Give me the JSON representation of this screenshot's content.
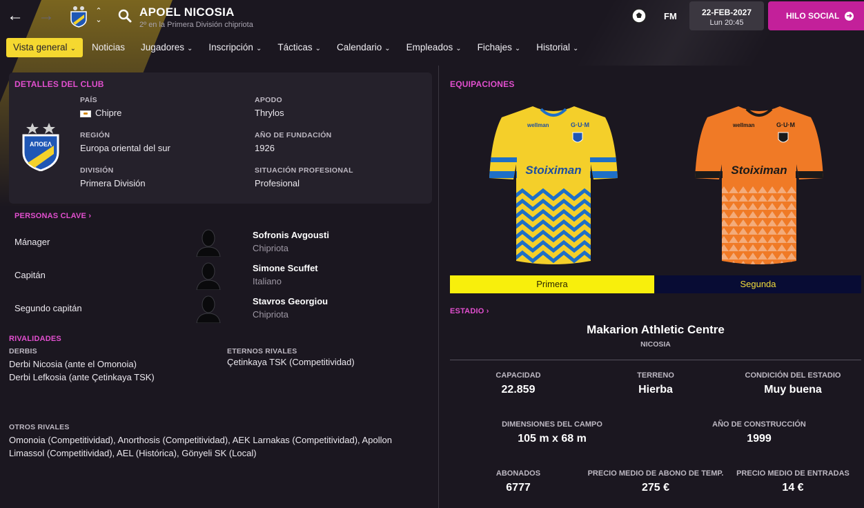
{
  "header": {
    "club_name": "APOEL NICOSIA",
    "club_subtitle": "2º en la Primera División chipriota",
    "fm_label": "FM",
    "date": "22-FEB-2027",
    "time": "Lun 20:45",
    "social_button": "HILO SOCIAL"
  },
  "menu": [
    {
      "label": "Vista general",
      "dropdown": true,
      "active": true
    },
    {
      "label": "Noticias",
      "dropdown": false
    },
    {
      "label": "Jugadores",
      "dropdown": true
    },
    {
      "label": "Inscripción",
      "dropdown": true
    },
    {
      "label": "Tácticas",
      "dropdown": true
    },
    {
      "label": "Calendario",
      "dropdown": true
    },
    {
      "label": "Empleados",
      "dropdown": true
    },
    {
      "label": "Fichajes",
      "dropdown": true
    },
    {
      "label": "Historial",
      "dropdown": true
    }
  ],
  "club_details": {
    "title": "DETALLES DEL CLUB",
    "country_label": "PAÍS",
    "country": "Chipre",
    "nickname_label": "APODO",
    "nickname": "Thrylos",
    "region_label": "REGIÓN",
    "region": "Europa oriental del sur",
    "founded_label": "AÑO DE FUNDACIÓN",
    "founded": "1926",
    "division_label": "DIVISIÓN",
    "division": "Primera División",
    "status_label": "SITUACIÓN PROFESIONAL",
    "status": "Profesional",
    "crest_text": "ΑΠΟΕΛ"
  },
  "key_people": {
    "title": "PERSONAS CLAVE",
    "people": [
      {
        "role": "Mánager",
        "name": "Sofronis Avgousti",
        "nationality": "Chipriota"
      },
      {
        "role": "Capitán",
        "name": "Simone Scuffet",
        "nationality": "Italiano"
      },
      {
        "role": "Segundo capitán",
        "name": "Stavros Georgiou",
        "nationality": "Chipriota"
      }
    ]
  },
  "rivalries": {
    "title": "RIVALIDADES",
    "derbies_label": "DERBIS",
    "derbies": [
      "Derbi Nicosia (ante el Omonoia)",
      "Derbi Lefkosia (ante Çetinkaya TSK)"
    ],
    "eternal_label": "ETERNOS RIVALES",
    "eternal": "Çetinkaya TSK (Competitividad)",
    "others_label": "OTROS RIVALES",
    "others_line1": "Omonoia (Competitividad), Anorthosis (Competitividad), AEK Larnakas (Competitividad), Apollon",
    "others_line2": "Limassol (Competitividad), AEL (Histórica), Gönyeli SK (Local)"
  },
  "kits": {
    "title": "EQUIPACIONES",
    "sponsor": "Stoiximan",
    "brand": "wellman",
    "maker": "G·U·M",
    "first": {
      "label": "Primera",
      "color": "#f8ef0c",
      "text_color": "#2b2600"
    },
    "second": {
      "label": "Segunda",
      "color": "#080c34",
      "text_color": "#f3dd3b"
    }
  },
  "stadium": {
    "title": "ESTADIO",
    "name": "Makarion Athletic Centre",
    "city": "NICOSIA",
    "capacity_label": "CAPACIDAD",
    "capacity": "22.859",
    "surface_label": "TERRENO",
    "surface": "Hierba",
    "condition_label": "CONDICIÓN DEL ESTADIO",
    "condition": "Muy buena",
    "dimensions_label": "DIMENSIONES DEL CAMPO",
    "dimensions": "105 m x 68 m",
    "built_label": "AÑO DE CONSTRUCCIÓN",
    "built": "1999",
    "season_tickets_label": "ABONADOS",
    "season_tickets": "6777",
    "avg_season_price_label": "PRECIO MEDIO DE ABONO DE TEMP.",
    "avg_season_price": "275 €",
    "avg_ticket_label": "PRECIO MEDIO DE ENTRADAS",
    "avg_ticket": "14 €"
  },
  "colors": {
    "accent": "#e24fcf",
    "menu_active": "#f5d830",
    "social_button": "#c3209a",
    "panel": "#25212b",
    "background": "#1b1720"
  }
}
